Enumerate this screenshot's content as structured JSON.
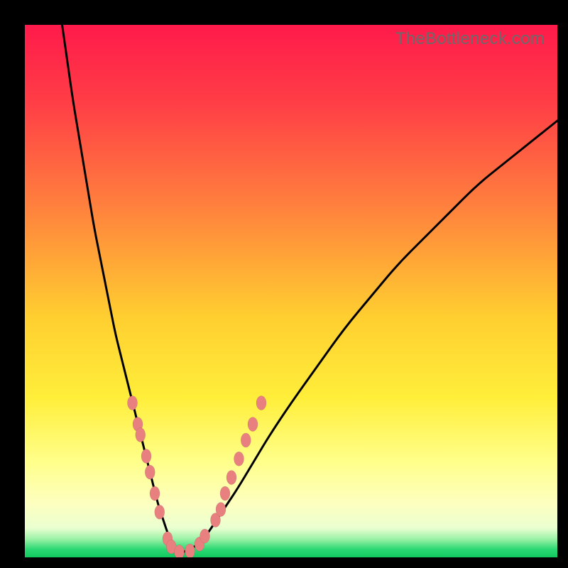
{
  "watermark": "TheBottleneck.com",
  "chart_data": {
    "type": "line",
    "title": "",
    "xlabel": "",
    "ylabel": "",
    "xlim": [
      0,
      100
    ],
    "ylim": [
      0,
      100
    ],
    "gradient_stops": [
      {
        "offset": 0,
        "color": "#ff1a4b"
      },
      {
        "offset": 0.15,
        "color": "#ff3f46"
      },
      {
        "offset": 0.35,
        "color": "#ff843d"
      },
      {
        "offset": 0.55,
        "color": "#ffcf30"
      },
      {
        "offset": 0.7,
        "color": "#ffee3a"
      },
      {
        "offset": 0.82,
        "color": "#ffff8a"
      },
      {
        "offset": 0.9,
        "color": "#fdffc0"
      },
      {
        "offset": 0.945,
        "color": "#eaffd0"
      },
      {
        "offset": 0.965,
        "color": "#9ef2a8"
      },
      {
        "offset": 0.985,
        "color": "#2bd873"
      },
      {
        "offset": 1.0,
        "color": "#11c95f"
      }
    ],
    "series": [
      {
        "name": "bottleneck-curve",
        "x": [
          7,
          8,
          9,
          10,
          11,
          12,
          13,
          14,
          15,
          16,
          17,
          18,
          19,
          20,
          21,
          22,
          23,
          24,
          25,
          26,
          27,
          28,
          29,
          30,
          32,
          34,
          36,
          38,
          40,
          43,
          46,
          50,
          55,
          60,
          65,
          70,
          75,
          80,
          85,
          90,
          95,
          100
        ],
        "values": [
          100,
          93,
          86,
          80,
          74,
          68,
          62,
          57,
          52,
          47,
          42,
          38,
          34,
          30,
          26,
          22,
          18,
          14,
          10,
          7,
          4,
          2,
          1,
          1,
          2,
          4,
          7,
          10,
          13,
          18,
          23,
          29,
          36,
          43,
          49,
          55,
          60,
          65,
          70,
          74,
          78,
          82
        ]
      }
    ],
    "markers": {
      "name": "curve-dots",
      "points": [
        {
          "x": 20.2,
          "y": 29.0
        },
        {
          "x": 21.2,
          "y": 25.0
        },
        {
          "x": 21.7,
          "y": 23.0
        },
        {
          "x": 22.8,
          "y": 19.0
        },
        {
          "x": 23.5,
          "y": 16.0
        },
        {
          "x": 24.4,
          "y": 12.0
        },
        {
          "x": 25.3,
          "y": 8.5
        },
        {
          "x": 26.8,
          "y": 3.5
        },
        {
          "x": 27.5,
          "y": 2.0
        },
        {
          "x": 29.0,
          "y": 1.0
        },
        {
          "x": 31.0,
          "y": 1.2
        },
        {
          "x": 32.8,
          "y": 2.5
        },
        {
          "x": 33.8,
          "y": 4.0
        },
        {
          "x": 35.8,
          "y": 7.0
        },
        {
          "x": 36.8,
          "y": 9.0
        },
        {
          "x": 37.6,
          "y": 12.0
        },
        {
          "x": 38.8,
          "y": 15.0
        },
        {
          "x": 40.2,
          "y": 18.5
        },
        {
          "x": 41.5,
          "y": 22.0
        },
        {
          "x": 42.8,
          "y": 25.0
        },
        {
          "x": 44.4,
          "y": 29.0
        }
      ]
    }
  }
}
